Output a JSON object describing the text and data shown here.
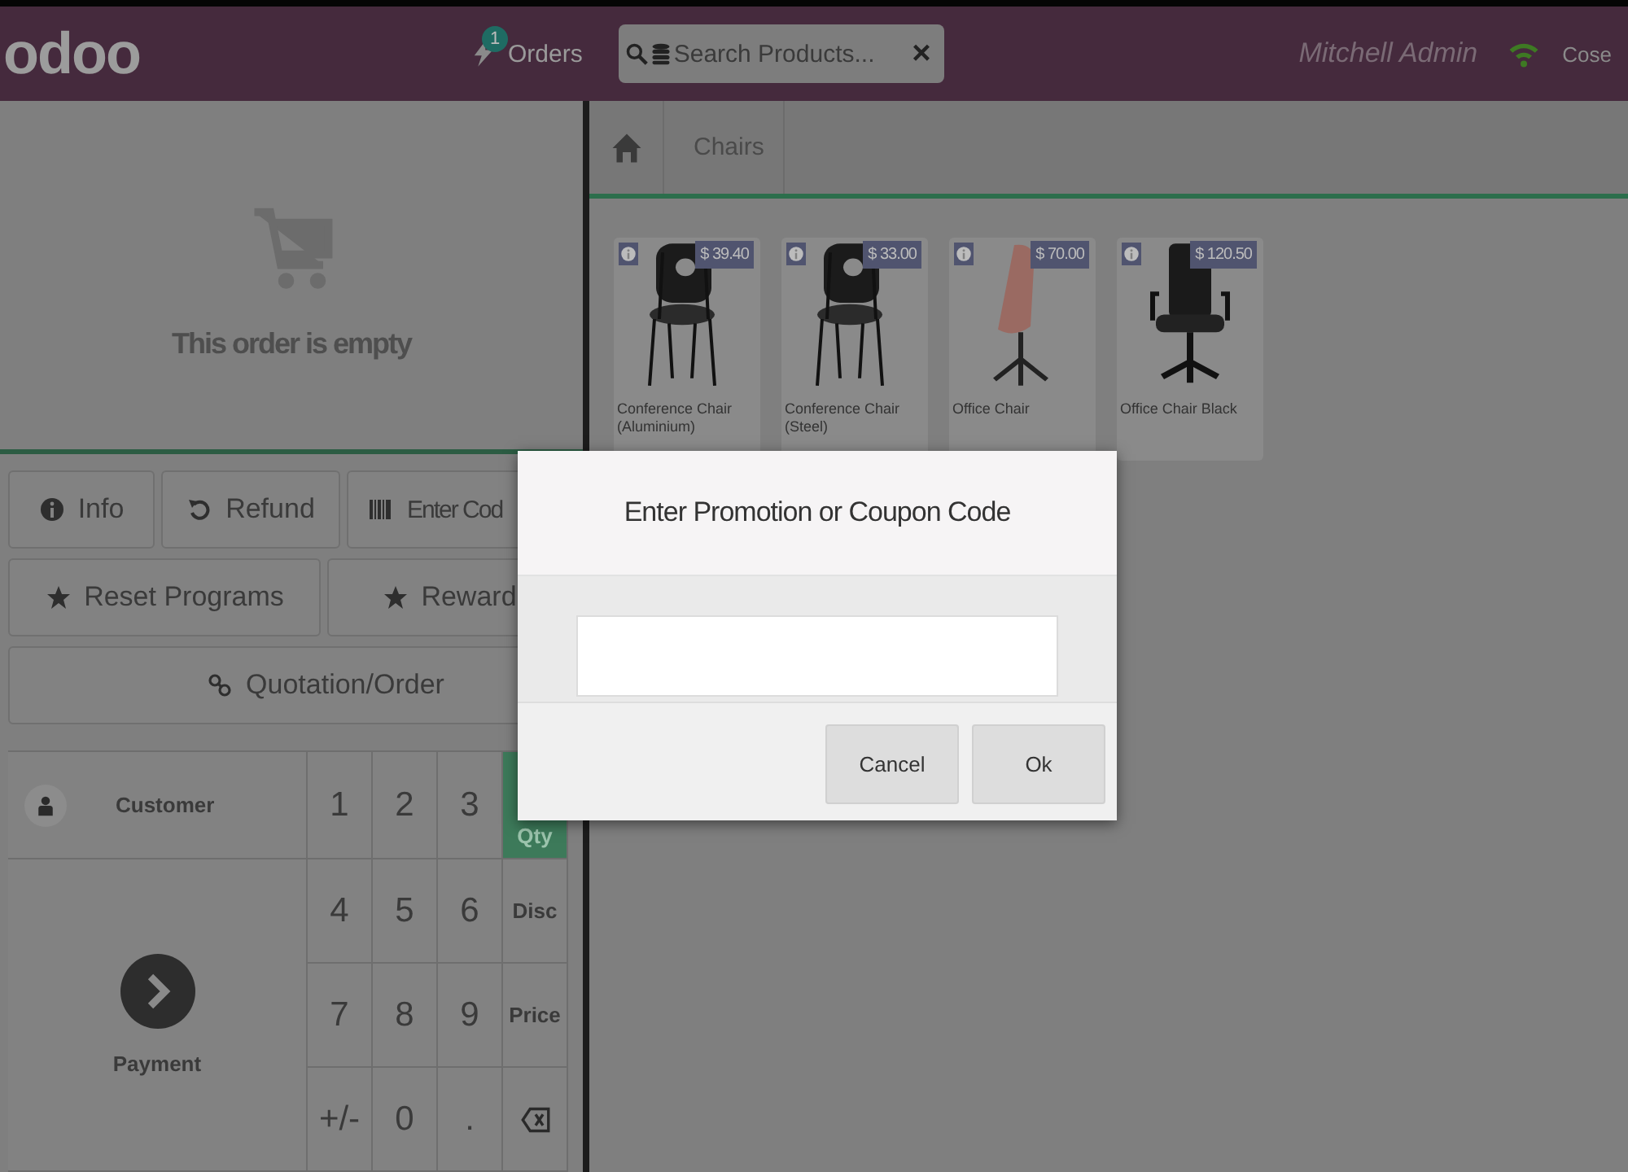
{
  "header": {
    "logo": "odoo",
    "orders": {
      "label": "Orders",
      "badge": "1"
    },
    "search": {
      "placeholder": "Search Products...",
      "clear": "×"
    },
    "user": "Mitchell Admin",
    "close": "Cose"
  },
  "breadcrumb": [
    "Chairs"
  ],
  "products": [
    {
      "name": "Conference Chair (Aluminium)",
      "price": "$ 39.40"
    },
    {
      "name": "Conference Chair (Steel)",
      "price": "$ 33.00"
    },
    {
      "name": "Office Chair",
      "price": "$ 70.00"
    },
    {
      "name": "Office Chair Black",
      "price": "$ 120.50"
    }
  ],
  "order": {
    "empty_text": "This order is empty"
  },
  "actions": [
    [
      {
        "kind": "info",
        "label": "Info"
      },
      {
        "kind": "refund",
        "label": "Refund"
      },
      {
        "kind": "barcode",
        "label": "Enter Cod"
      }
    ],
    [
      {
        "kind": "star",
        "label": "Reset Programs"
      },
      {
        "kind": "star",
        "label": "Reward"
      }
    ],
    [
      {
        "kind": "link",
        "label": "Quotation/Order"
      }
    ]
  ],
  "numpad": {
    "customer": "Customer",
    "payment": "Payment",
    "keys": [
      [
        "1",
        "2",
        "3"
      ],
      [
        "4",
        "5",
        "6"
      ],
      [
        "7",
        "8",
        "9"
      ],
      [
        "+/-",
        "0",
        "."
      ]
    ],
    "modes": [
      {
        "label": "Qty",
        "kind": "text",
        "selected": true
      },
      {
        "label": "Disc",
        "kind": "text",
        "selected": false
      },
      {
        "label": "Price",
        "kind": "text",
        "selected": false
      },
      {
        "kind": "backspace",
        "selected": false
      }
    ]
  },
  "dialog": {
    "title": "Enter Promotion or Coupon Code",
    "buttons": [
      "Cancel",
      "Ok"
    ]
  }
}
